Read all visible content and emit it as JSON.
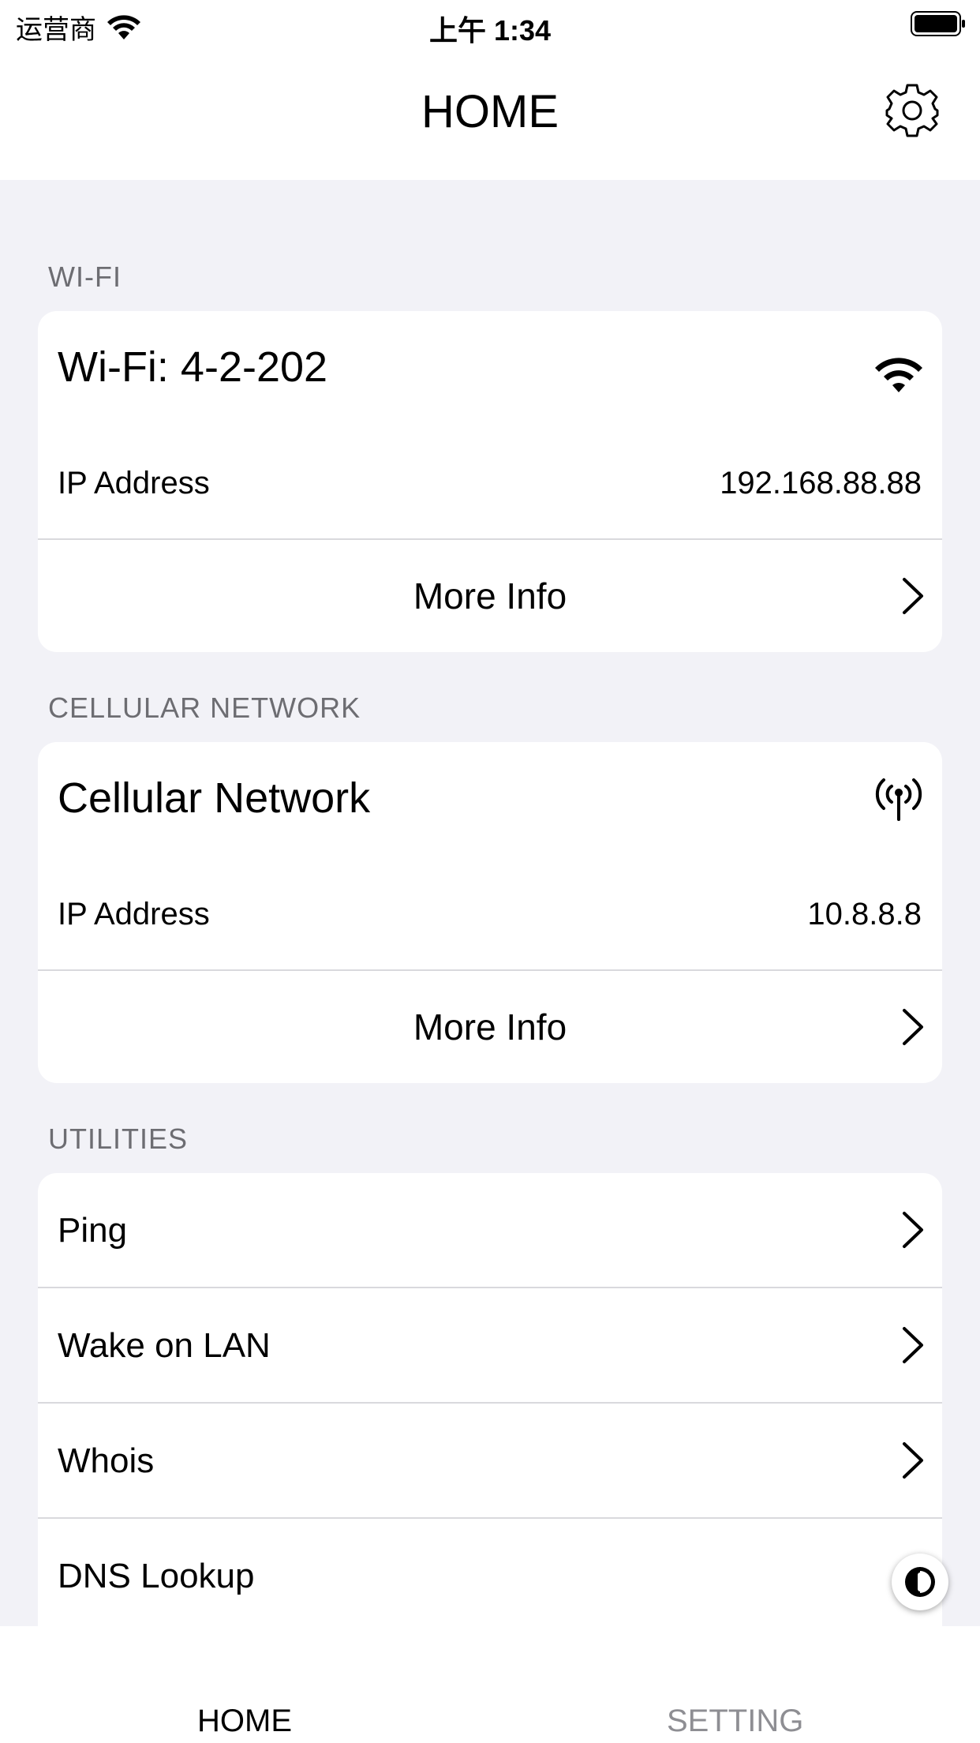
{
  "status_bar": {
    "carrier": "运营商",
    "time": "上午 1:34"
  },
  "nav": {
    "title": "HOME"
  },
  "wifi_section": {
    "header": "WI-FI",
    "title": "Wi-Fi: 4-2-202",
    "ip_label": "IP Address",
    "ip_value": "192.168.88.88",
    "more_info": "More Info"
  },
  "cellular_section": {
    "header": "CELLULAR NETWORK",
    "title": "Cellular Network",
    "ip_label": "IP Address",
    "ip_value": "10.8.8.8",
    "more_info": "More Info"
  },
  "utilities_section": {
    "header": "UTILITIES",
    "items": [
      {
        "label": "Ping"
      },
      {
        "label": "Wake on LAN"
      },
      {
        "label": "Whois"
      },
      {
        "label": "DNS Lookup"
      }
    ]
  },
  "tabs": [
    {
      "label": "HOME",
      "active": true
    },
    {
      "label": "SETTING",
      "active": false
    }
  ]
}
